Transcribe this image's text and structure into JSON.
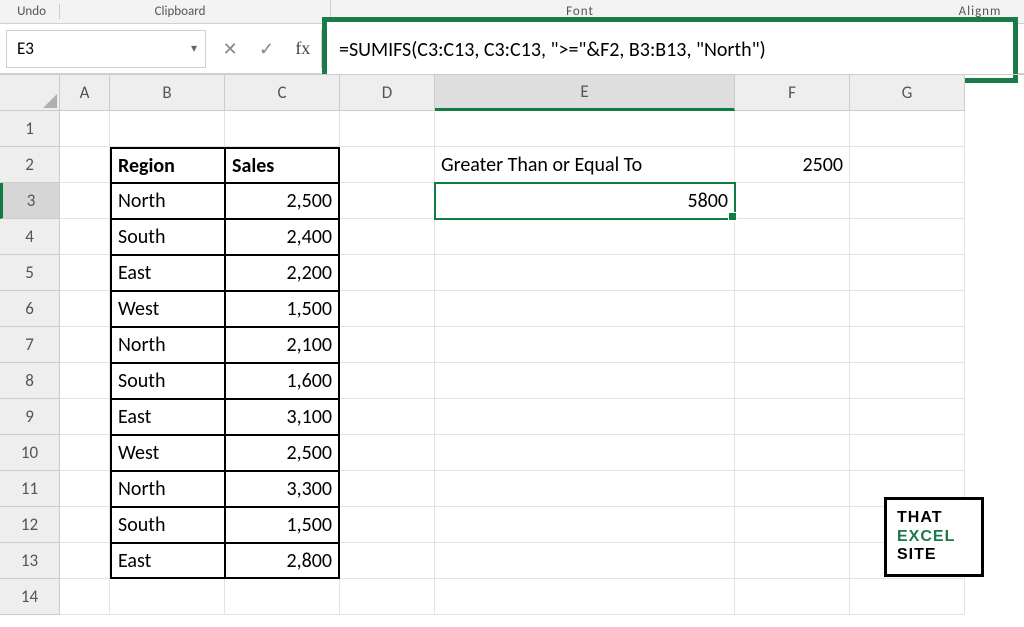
{
  "ribbon": {
    "undo": "Undo",
    "clipboard": "Clipboard",
    "font": "Font",
    "alignment": "Alignm"
  },
  "nameBox": {
    "value": "E3"
  },
  "formulaBar": {
    "value": "=SUMIFS(C3:C13, C3:C13, \">=\"&F2, B3:B13, \"North\")"
  },
  "columns": {
    "A": "A",
    "B": "B",
    "C": "C",
    "D": "D",
    "E": "E",
    "F": "F",
    "G": "G"
  },
  "rows": [
    "1",
    "2",
    "3",
    "4",
    "5",
    "6",
    "7",
    "8",
    "9",
    "10",
    "11",
    "12",
    "13",
    "14"
  ],
  "table": {
    "headers": {
      "region": "Region",
      "sales": "Sales"
    },
    "rows": [
      {
        "region": "North",
        "sales": "2,500"
      },
      {
        "region": "South",
        "sales": "2,400"
      },
      {
        "region": "East",
        "sales": "2,200"
      },
      {
        "region": "West",
        "sales": "1,500"
      },
      {
        "region": "North",
        "sales": "2,100"
      },
      {
        "region": "South",
        "sales": "1,600"
      },
      {
        "region": "East",
        "sales": "3,100"
      },
      {
        "region": "West",
        "sales": "2,500"
      },
      {
        "region": "North",
        "sales": "3,300"
      },
      {
        "region": "South",
        "sales": "1,500"
      },
      {
        "region": "East",
        "sales": "2,800"
      }
    ]
  },
  "criteria": {
    "label": "Greater Than or Equal To",
    "value": "2500",
    "result": "5800"
  },
  "logo": {
    "l1": "THAT",
    "l2": "EXCEL",
    "l3": "SITE"
  }
}
